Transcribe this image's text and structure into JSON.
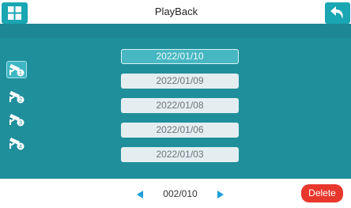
{
  "header": {
    "title": "PlayBack",
    "menu_icon": "grid-icon",
    "back_icon": "return-arrow-icon"
  },
  "cameras": [
    {
      "number": "1",
      "icon": "cctv-camera-icon",
      "selected": true
    },
    {
      "number": "2",
      "icon": "cctv-camera-icon",
      "selected": false
    },
    {
      "number": "3",
      "icon": "cctv-camera-icon",
      "selected": false
    },
    {
      "number": "4",
      "icon": "cctv-camera-icon",
      "selected": false
    }
  ],
  "dates": [
    {
      "label": "2022/01/10",
      "selected": true
    },
    {
      "label": "2022/01/09",
      "selected": false
    },
    {
      "label": "2022/01/08",
      "selected": false
    },
    {
      "label": "2022/01/06",
      "selected": false
    },
    {
      "label": "2022/01/03",
      "selected": false
    }
  ],
  "pager": {
    "page": "002/010",
    "prev_icon": "triangle-left-icon",
    "next_icon": "triangle-right-icon"
  },
  "actions": {
    "delete_label": "Delete"
  },
  "colors": {
    "accent": "#1aa6b3",
    "background": "#208f9c",
    "delete": "#e8372c",
    "arrow": "#1d9ed9"
  }
}
